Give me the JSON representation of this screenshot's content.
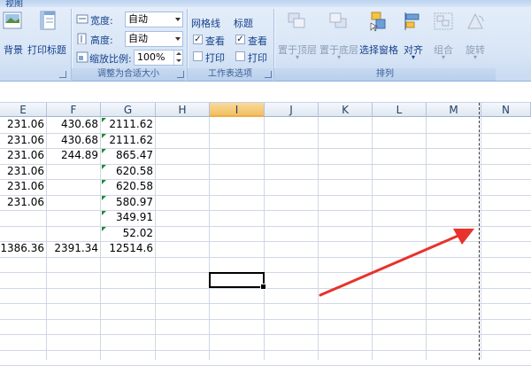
{
  "tab": {
    "view_label": "视图"
  },
  "ribbon": {
    "background_label": "背景",
    "print_titles_label": "打印标题",
    "scale_group": {
      "width_label": "宽度:",
      "width_value": "自动",
      "height_label": "高度:",
      "height_value": "自动",
      "scale_label": "缩放比例:",
      "scale_value": "100%",
      "group_label": "调整为合适大小"
    },
    "sheet_options": {
      "gridlines_label": "网格线",
      "headings_label": "标题",
      "view_label_1": "查看",
      "view_label_2": "查看",
      "print_label_1": "打印",
      "print_label_2": "打印",
      "group_label": "工作表选项"
    },
    "arrange": {
      "bring_front_label": "置于顶层",
      "send_back_label": "置于底层",
      "selection_pane_label": "选择窗格",
      "align_label": "对齐",
      "group_label": "组合",
      "rotate_label": "旋转",
      "section_label": "排列"
    }
  },
  "sheet": {
    "columns": [
      "E",
      "F",
      "G",
      "H",
      "I",
      "J",
      "K",
      "L",
      "M",
      "N"
    ],
    "selected_column": "I",
    "rows": [
      {
        "E": "231.06",
        "F": "430.68",
        "G": "2111.62"
      },
      {
        "E": "231.06",
        "F": "430.68",
        "G": "2111.62"
      },
      {
        "E": "231.06",
        "F": "244.89",
        "G": "865.47"
      },
      {
        "E": "231.06",
        "F": "",
        "G": "620.58"
      },
      {
        "E": "231.06",
        "F": "",
        "G": "620.58"
      },
      {
        "E": "231.06",
        "F": "",
        "G": "580.97"
      },
      {
        "E": "",
        "F": "",
        "G": "349.91"
      },
      {
        "E": "",
        "F": "",
        "G": "52.02"
      },
      {
        "E": "1386.36",
        "F": "2391.34",
        "G": "12514.6"
      }
    ]
  },
  "annotation": {
    "arrow_color": "#e8322b"
  }
}
